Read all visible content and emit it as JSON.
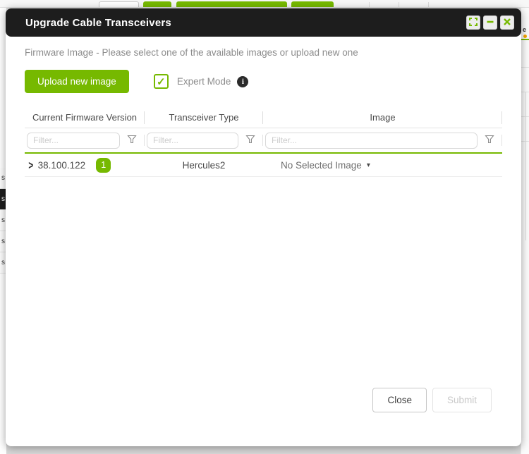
{
  "window": {
    "title": "Upgrade Cable Transceivers"
  },
  "content": {
    "description": "Firmware Image - Please select one of the available images or upload new one",
    "upload_button_label": "Upload new image",
    "expert_mode_label": "Expert Mode",
    "expert_mode_checked": true
  },
  "icons": {
    "checkmark": "✓",
    "info": "i",
    "expander": ">",
    "dropdown_caret": "▾"
  },
  "table": {
    "columns": [
      {
        "label": "Current Firmware Version",
        "filter_placeholder": "Filter..."
      },
      {
        "label": "Transceiver Type",
        "filter_placeholder": "Filter..."
      },
      {
        "label": "Image",
        "filter_placeholder": "Filter..."
      }
    ],
    "rows": [
      {
        "firmware_version": "38.100.122",
        "badge_count": "1",
        "transceiver_type": "Hercules2",
        "image_selection": "No Selected Image"
      }
    ]
  },
  "footer": {
    "close_label": "Close",
    "submit_label": "Submit",
    "submit_disabled": true
  },
  "colors": {
    "accent_green": "#76b900",
    "titlebar_bg": "#1d1d1d",
    "badge_green": "#76b900",
    "background_dot_orange": "#f5a300"
  },
  "background": {
    "left_row_labels": [
      "s",
      "s",
      "s",
      "s",
      "s"
    ],
    "right_edge_label": "e"
  }
}
